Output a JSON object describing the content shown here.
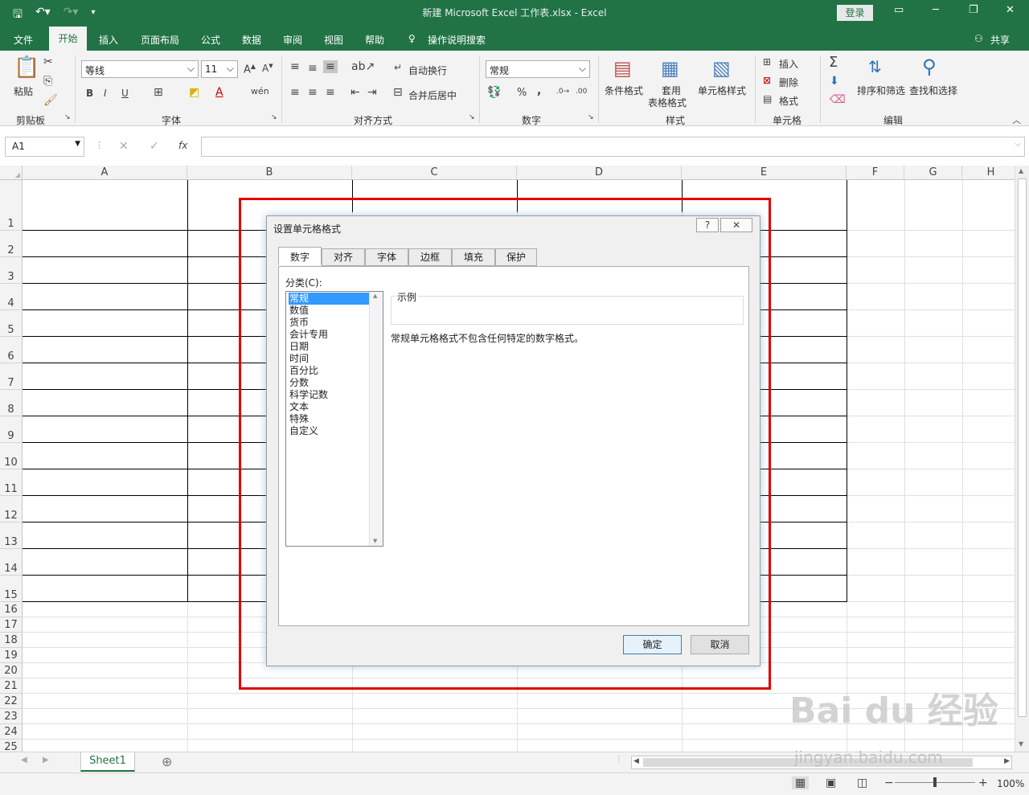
{
  "window": {
    "title": "新建 Microsoft Excel 工作表.xlsx  -  Excel",
    "login": "登录",
    "share": "共享"
  },
  "qat": {
    "save_icon": "save-icon",
    "undo_icon": "undo-icon",
    "redo_icon": "redo-icon"
  },
  "menu": [
    "文件",
    "开始",
    "插入",
    "页面布局",
    "公式",
    "数据",
    "审阅",
    "视图",
    "帮助",
    "操作说明搜索"
  ],
  "ribbon": {
    "paste": "粘贴",
    "clipboard": "剪贴板",
    "font_name": "等线",
    "font_size": "11",
    "font_group": "字体",
    "wrap": "自动换行",
    "merge": "合并后居中",
    "align_group": "对齐方式",
    "number_format": "常规",
    "number_group": "数字",
    "cond_format": "条件格式",
    "table_format_1": "套用",
    "table_format_2": "表格格式",
    "cell_style": "单元格样式",
    "styles_group": "样式",
    "insert": "插入",
    "delete": "删除",
    "format": "格式",
    "cells_group": "单元格",
    "sort_filter": "排序和筛选",
    "find_select": "查找和选择",
    "edit_group": "编辑",
    "bold": "B",
    "italic": "I",
    "underline": "U",
    "percent": "%",
    "comma": ","
  },
  "formula_bar": {
    "name_box": "A1",
    "fx": "fx",
    "cancel": "✕",
    "enter": "✓"
  },
  "columns": [
    "A",
    "B",
    "C",
    "D",
    "E",
    "F",
    "G",
    "H"
  ],
  "rows": [
    "1",
    "2",
    "3",
    "4",
    "5",
    "6",
    "7",
    "8",
    "9",
    "10",
    "11",
    "12",
    "13",
    "14",
    "15",
    "16",
    "17",
    "18",
    "19",
    "20",
    "21",
    "22",
    "23",
    "24",
    "25"
  ],
  "sheet": {
    "tab": "Sheet1",
    "add": "⊕"
  },
  "status": {
    "zoom": "100%",
    "minus": "−",
    "plus": "+"
  },
  "dialog": {
    "title": "设置单元格格式",
    "help": "?",
    "close": "✕",
    "tabs": [
      "数字",
      "对齐",
      "字体",
      "边框",
      "填充",
      "保护"
    ],
    "category_label": "分类(C):",
    "categories": [
      "常规",
      "数值",
      "货币",
      "会计专用",
      "日期",
      "时间",
      "百分比",
      "分数",
      "科学记数",
      "文本",
      "特殊",
      "自定义"
    ],
    "sample_label": "示例",
    "description": "常规单元格格式不包含任何特定的数字格式。",
    "ok": "确定",
    "cancel": "取消"
  },
  "watermark": {
    "main": "Bai du 经验",
    "sub": "jingyan.baidu.com"
  },
  "colors": {
    "excel_green": "#217346",
    "highlight_red": "#e00000",
    "selection_blue": "#3399ff"
  }
}
